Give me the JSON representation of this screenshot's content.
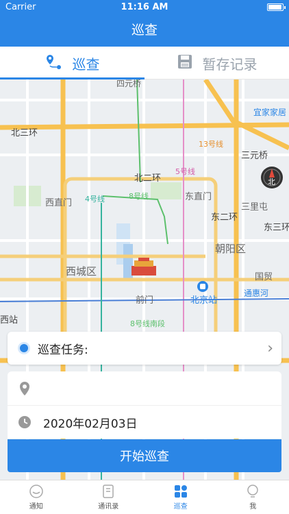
{
  "status": {
    "carrier": "Carrier",
    "time": "11:16 AM"
  },
  "nav": {
    "title": "巡查"
  },
  "tabs": [
    {
      "label": "巡查",
      "active": true,
      "icon": "map-pin-route-icon"
    },
    {
      "label": "暂存记录",
      "active": false,
      "icon": "save-icon"
    }
  ],
  "map": {
    "labels": [
      {
        "text": "北三环"
      },
      {
        "text": "四元桥"
      },
      {
        "text": "北二环"
      },
      {
        "text": "三元桥"
      },
      {
        "text": "西直门"
      },
      {
        "text": "东直门"
      },
      {
        "text": "三里屯"
      },
      {
        "text": "东二环"
      },
      {
        "text": "东三环"
      },
      {
        "text": "朝阳区"
      },
      {
        "text": "西城区"
      },
      {
        "text": "国贸"
      },
      {
        "text": "前门"
      },
      {
        "text": "北京站"
      },
      {
        "text": "通惠河"
      },
      {
        "text": "宜家家居"
      },
      {
        "text": "13号线"
      },
      {
        "text": "5号线"
      },
      {
        "text": "4号线"
      },
      {
        "text": "8号线"
      },
      {
        "text": "8号线南段"
      },
      {
        "text": "西站"
      },
      {
        "text": "北"
      }
    ]
  },
  "form": {
    "task_label": "巡查任务:",
    "location_value": "",
    "date_value": "2020年02月03日",
    "start_button": "开始巡查"
  },
  "tabbar": [
    {
      "label": "通知",
      "icon": "notice-icon",
      "selected": false
    },
    {
      "label": "通讯录",
      "icon": "contacts-icon",
      "selected": false
    },
    {
      "label": "巡查",
      "icon": "patrol-icon",
      "selected": true
    },
    {
      "label": "我",
      "icon": "user-icon",
      "selected": false
    }
  ],
  "colors": {
    "accent": "#2b86e6",
    "map_bg": "#eceff2",
    "road_major": "#f7c150",
    "road_minor": "#ffffff"
  }
}
